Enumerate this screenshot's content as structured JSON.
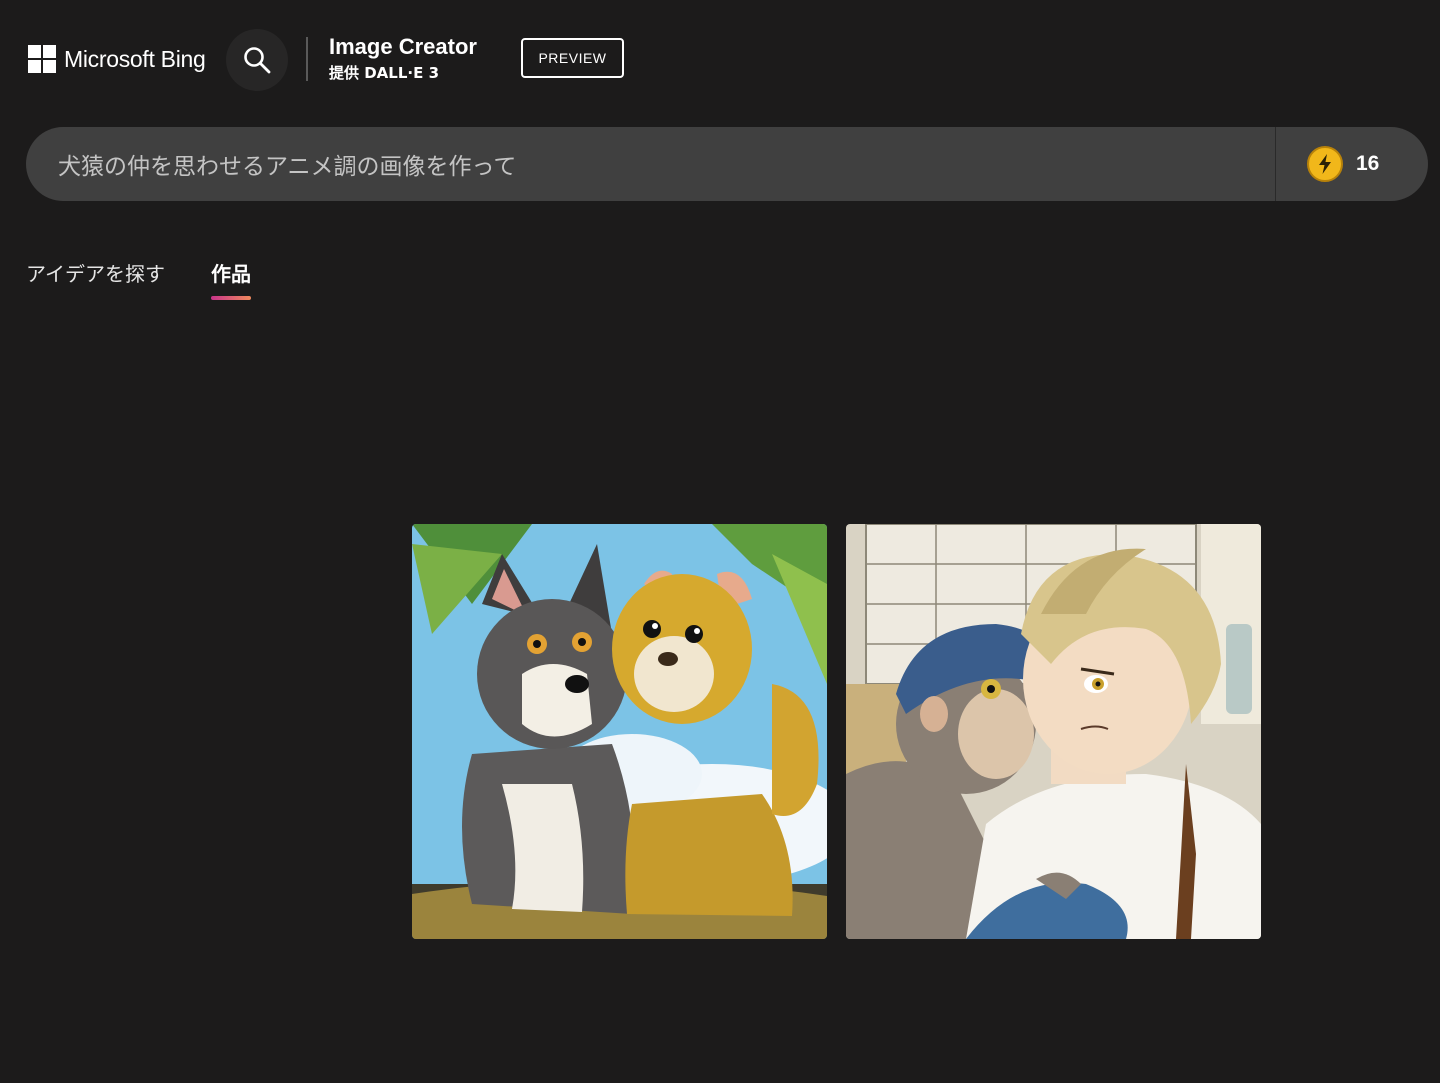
{
  "header": {
    "brand_name": "Microsoft Bing",
    "product_title": "Image Creator",
    "product_subtitle": "提供 DALL·E 3",
    "preview_label": "PREVIEW"
  },
  "prompt": {
    "text": "犬猿の仲を思わせるアニメ調の画像を作って",
    "boost_count": "16",
    "boost_icon": "lightning-coin-icon"
  },
  "tabs": [
    {
      "label": "アイデアを探す",
      "active": false
    },
    {
      "label": "作品",
      "active": true
    }
  ],
  "gallery": {
    "images": [
      {
        "alt": "anime-dog-and-monkey"
      },
      {
        "alt": "anime-monkey-and-boy"
      }
    ]
  },
  "colors": {
    "background": "#1c1b1b",
    "prompt_bar": "#404040",
    "coin": "#f1b71a",
    "tab_underline_start": "#c8348a",
    "tab_underline_end": "#f08a5d"
  }
}
